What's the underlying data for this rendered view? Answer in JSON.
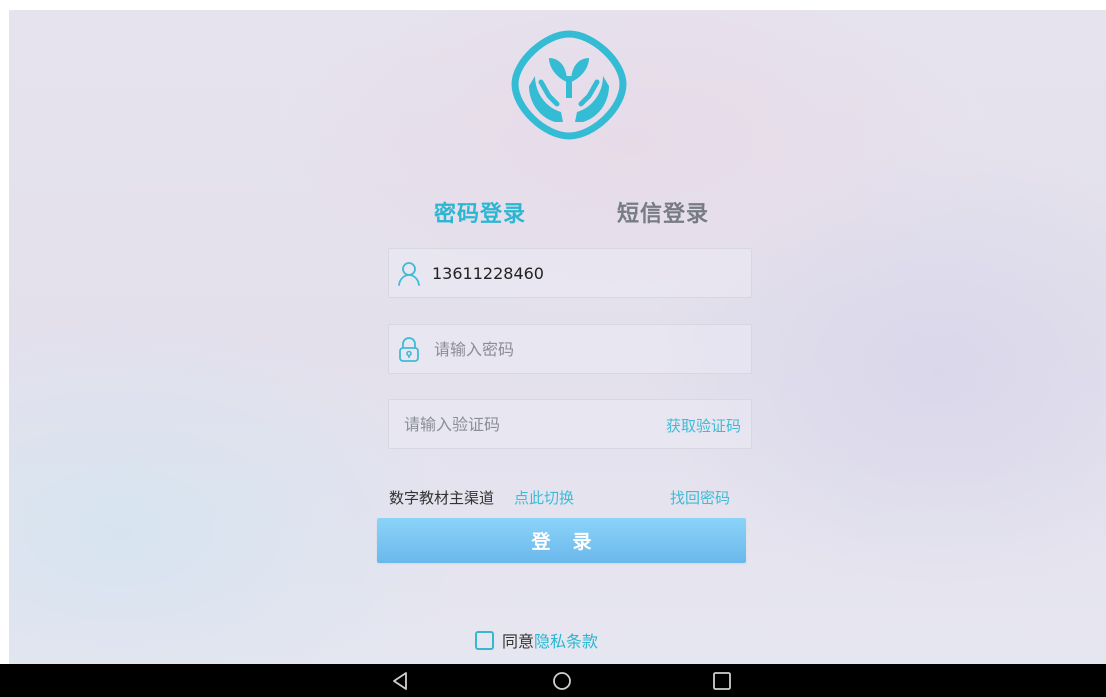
{
  "tabs": {
    "password_login": "密码登录",
    "sms_login": "短信登录"
  },
  "form": {
    "phone_value": "13611228460",
    "password_placeholder": "请输入密码",
    "captcha_placeholder": "请输入验证码",
    "get_captcha_label": "获取验证码"
  },
  "channel": {
    "label": "数字教材主渠道",
    "switch_link": "点此切换",
    "forgot_password": "找回密码"
  },
  "login_button": "登录",
  "agreement": {
    "checked": false,
    "prefix": "同意",
    "policy_link": "隐私条款"
  },
  "colors": {
    "accent": "#2bb6d2",
    "tab_inactive": "#777b86",
    "button_top": "#8bd3f8",
    "button_bottom": "#6ab8ec",
    "navbar": "#000000"
  },
  "icons": {
    "logo": "sprout-in-hands-logo",
    "user": "user-icon",
    "lock": "lock-icon",
    "nav_back": "triangle-back-icon",
    "nav_home": "circle-home-icon",
    "nav_recents": "square-recents-icon"
  }
}
